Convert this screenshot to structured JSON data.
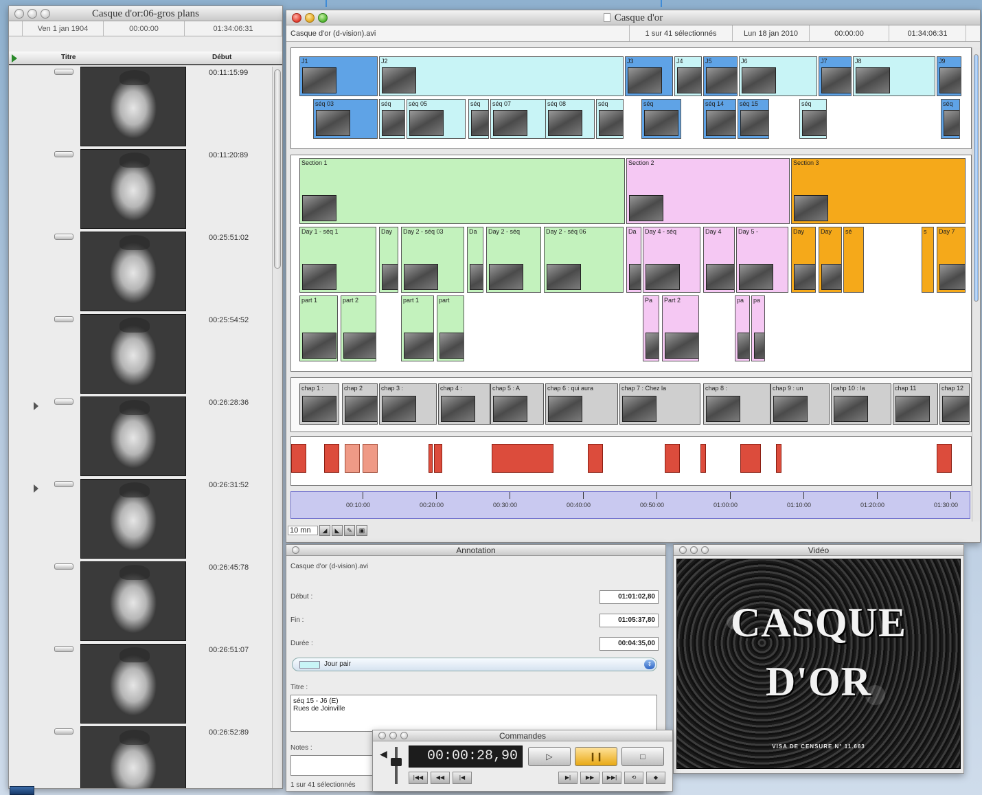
{
  "list_window": {
    "title": "Casque d'or:06-gros plans",
    "info": {
      "date": "Ven 1 jan 1904",
      "start": "00:00:00",
      "end": "01:34:06:31"
    },
    "columns": {
      "title": "Titre",
      "start": "Début"
    },
    "clips": [
      {
        "time": "00:11:15:99",
        "expanded": false
      },
      {
        "time": "00:11:20:89",
        "expanded": false
      },
      {
        "time": "00:25:51:02",
        "expanded": false
      },
      {
        "time": "00:25:54:52",
        "expanded": false
      },
      {
        "time": "00:26:28:36",
        "expanded": true
      },
      {
        "time": "00:26:31:52",
        "expanded": true
      },
      {
        "time": "00:26:45:78",
        "expanded": false
      },
      {
        "time": "00:26:51:07",
        "expanded": false
      },
      {
        "time": "00:26:52:89",
        "expanded": false
      }
    ]
  },
  "main_window": {
    "title": "Casque d'or",
    "info": {
      "file": "Casque d'or (d-vision).avi",
      "selection": "1 sur 41 sélectionnés",
      "date": "Lun 18 jan 2010",
      "start": "00:00:00",
      "end": "01:34:06:31"
    },
    "colors": {
      "light_blue": "#c8f4f6",
      "dark_blue": "#5fa3e6",
      "green": "#c3f2bd",
      "pink": "#f5c8f3",
      "orange": "#f5a91a",
      "grey": "#cfcfcf",
      "red": "#dc4c3c"
    },
    "track1_top": [
      {
        "label": "J1",
        "color": "dblue"
      },
      {
        "label": "J2",
        "color": "lblue"
      },
      {
        "label": "J3",
        "color": "dblue"
      },
      {
        "label": "J4",
        "color": "lblue"
      },
      {
        "label": "J5",
        "color": "dblue"
      },
      {
        "label": "J6",
        "color": "lblue"
      },
      {
        "label": "J7",
        "color": "dblue"
      },
      {
        "label": "J8",
        "color": "lblue"
      },
      {
        "label": "J9",
        "color": "dblue"
      }
    ],
    "track1_bottom": [
      {
        "label": "séq 03"
      },
      {
        "label": "séq"
      },
      {
        "label": "séq 05"
      },
      {
        "label": "séq"
      },
      {
        "label": "séq 07"
      },
      {
        "label": "séq 08"
      },
      {
        "label": "séq"
      },
      {
        "label": "séq"
      },
      {
        "label": "séq 14"
      },
      {
        "label": "séq 15"
      },
      {
        "label": "séq"
      },
      {
        "label": "séq"
      }
    ],
    "sections": [
      {
        "label": "Section 1"
      },
      {
        "label": "Section 2"
      },
      {
        "label": "Section 3"
      }
    ],
    "days": [
      {
        "label": "Day 1 - séq 1"
      },
      {
        "label": "Day"
      },
      {
        "label": "Day 2 - séq 03"
      },
      {
        "label": "Da"
      },
      {
        "label": "Day 2 - séq"
      },
      {
        "label": "Day 2 - séq 06"
      },
      {
        "label": "Da"
      },
      {
        "label": "Day 4 - séq"
      },
      {
        "label": "Day 4"
      },
      {
        "label": "Day 5 -"
      },
      {
        "label": "Day"
      },
      {
        "label": "Day"
      },
      {
        "label": "sé"
      },
      {
        "label": "s"
      },
      {
        "label": "Day 7"
      }
    ],
    "parts": [
      {
        "label": "part 1"
      },
      {
        "label": "part 2"
      },
      {
        "label": "part 1"
      },
      {
        "label": "part"
      },
      {
        "label": "Pa"
      },
      {
        "label": "Part 2"
      },
      {
        "label": "pa"
      },
      {
        "label": "pa"
      }
    ],
    "chapters": [
      {
        "label": "chap 1 :"
      },
      {
        "label": "chap 2"
      },
      {
        "label": "chap 3 :"
      },
      {
        "label": "chap 4 :"
      },
      {
        "label": "chap 5 : A"
      },
      {
        "label": "chap 6 : qui aura"
      },
      {
        "label": "chap 7 : Chez la"
      },
      {
        "label": "chap 8 :"
      },
      {
        "label": "chap 9 : un"
      },
      {
        "label": "cahp 10 : la"
      },
      {
        "label": "chap 11"
      },
      {
        "label": "chap 12"
      }
    ],
    "ruler": [
      "00:10:00",
      "00:20:00",
      "00:30:00",
      "00:40:00",
      "00:50:00",
      "01:00:00",
      "01:10:00",
      "01:20:00",
      "01:30:00"
    ],
    "zoom": "10 mn"
  },
  "annotation_window": {
    "title": "Annotation",
    "file": "Casque d'or (d-vision).avi",
    "labels": {
      "start": "Début :",
      "end": "Fin :",
      "duration": "Durée :",
      "title": "Titre :",
      "notes": "Notes :"
    },
    "values": {
      "start": "01:01:02,80",
      "end": "01:05:37,80",
      "duration": "00:04:35,00"
    },
    "category": "Jour pair",
    "title_text": "séq 15 - J6 (E)\nRues de Joinville",
    "status": "1 sur 41 sélectionnés"
  },
  "video_window": {
    "title": "Vidéo",
    "line1": "CASQUE",
    "line2": "D'OR",
    "censure": "VISA DE CENSURE N° 11.663"
  },
  "commands_window": {
    "title": "Commandes",
    "timecode": "00:00:28,90",
    "play": "▷",
    "pause": "❙❙",
    "stop": "□"
  }
}
